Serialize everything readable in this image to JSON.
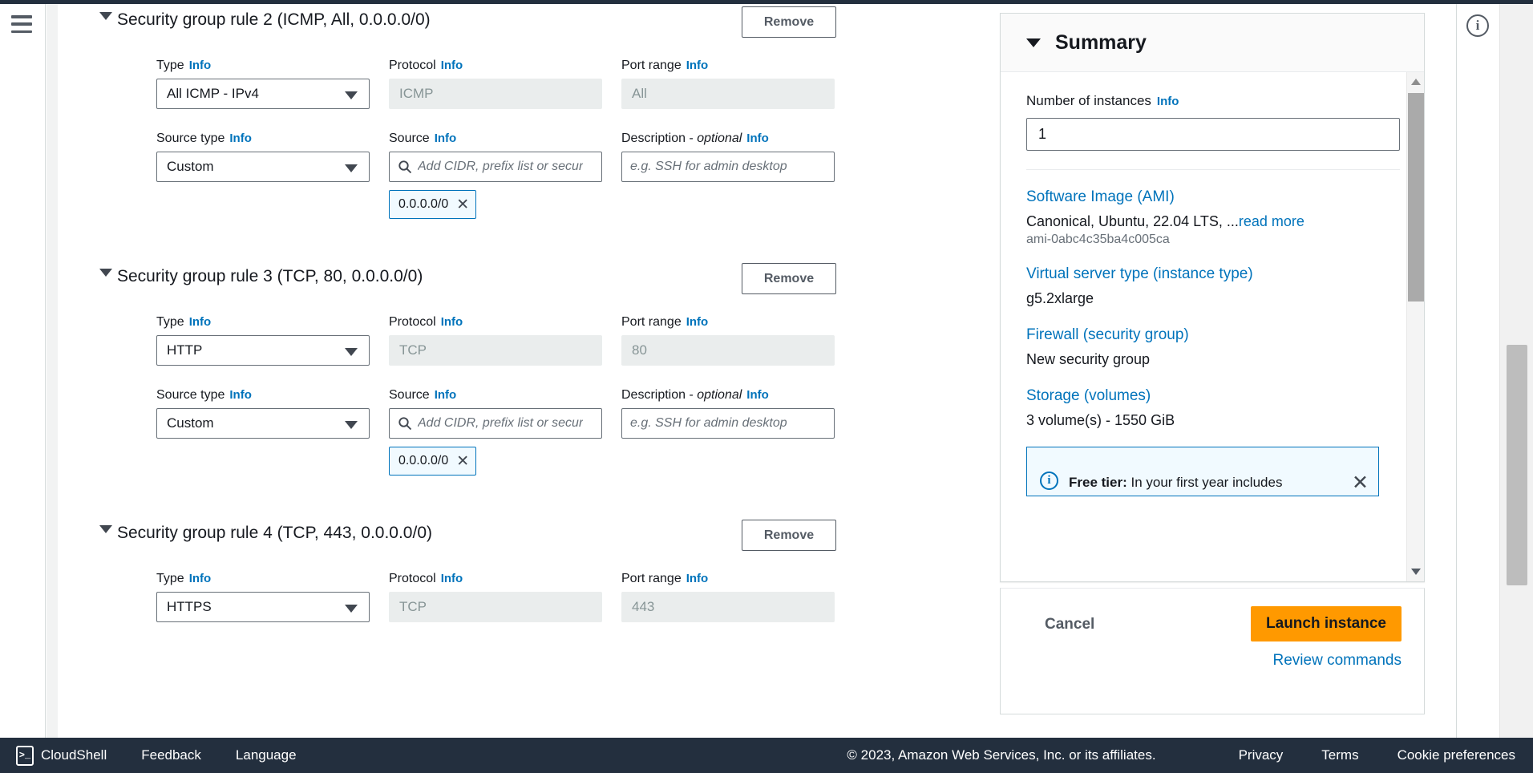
{
  "nav": {
    "menu_icon": "hamburger-icon",
    "info_icon": "info-circle-icon"
  },
  "rules": [
    {
      "title": "Security group rule 2 (ICMP, All, 0.0.0.0/0)",
      "remove_label": "Remove",
      "type_label": "Type",
      "type_value": "All ICMP - IPv4",
      "protocol_label": "Protocol",
      "protocol_value": "ICMP",
      "port_label": "Port range",
      "port_value": "All",
      "source_type_label": "Source type",
      "source_type_value": "Custom",
      "source_label": "Source",
      "source_placeholder": "Add CIDR, prefix list or secur",
      "source_token": "0.0.0.0/0",
      "description_label": "Description - ",
      "description_label_em": "optional",
      "description_placeholder": "e.g. SSH for admin desktop",
      "info_label": "Info"
    },
    {
      "title": "Security group rule 3 (TCP, 80, 0.0.0.0/0)",
      "remove_label": "Remove",
      "type_label": "Type",
      "type_value": "HTTP",
      "protocol_label": "Protocol",
      "protocol_value": "TCP",
      "port_label": "Port range",
      "port_value": "80",
      "source_type_label": "Source type",
      "source_type_value": "Custom",
      "source_label": "Source",
      "source_placeholder": "Add CIDR, prefix list or secur",
      "source_token": "0.0.0.0/0",
      "description_label": "Description - ",
      "description_label_em": "optional",
      "description_placeholder": "e.g. SSH for admin desktop",
      "info_label": "Info"
    },
    {
      "title": "Security group rule 4 (TCP, 443, 0.0.0.0/0)",
      "remove_label": "Remove",
      "type_label": "Type",
      "type_value": "HTTPS",
      "protocol_label": "Protocol",
      "protocol_value": "TCP",
      "port_label": "Port range",
      "port_value": "443",
      "info_label": "Info"
    }
  ],
  "summary": {
    "title": "Summary",
    "instances_label": "Number of instances",
    "instances_info": "Info",
    "instances_value": "1",
    "ami_link": "Software Image (AMI)",
    "ami_value": "Canonical, Ubuntu, 22.04 LTS, ...",
    "ami_readmore": "read more",
    "ami_id": "ami-0abc4c35ba4c005ca",
    "instance_type_link": "Virtual server type (instance type)",
    "instance_type_value": "g5.2xlarge",
    "firewall_link": "Firewall (security group)",
    "firewall_value": "New security group",
    "storage_link": "Storage (volumes)",
    "storage_value": "3 volume(s) - 1550 GiB",
    "freetier_bold": "Free tier:",
    "freetier_text": " In your first year includes",
    "freetier_close": "close-icon"
  },
  "actions": {
    "cancel": "Cancel",
    "launch": "Launch instance",
    "review": "Review commands"
  },
  "footer": {
    "cloudshell": "CloudShell",
    "cloudshell_glyph": ">_",
    "feedback": "Feedback",
    "language": "Language",
    "copyright": "© 2023, Amazon Web Services, Inc. or its affiliates.",
    "privacy": "Privacy",
    "terms": "Terms",
    "cookies": "Cookie preferences"
  },
  "colors": {
    "accent_orange": "#ff9900",
    "link_blue": "#0073bb",
    "dark_navy": "#232f3e"
  }
}
